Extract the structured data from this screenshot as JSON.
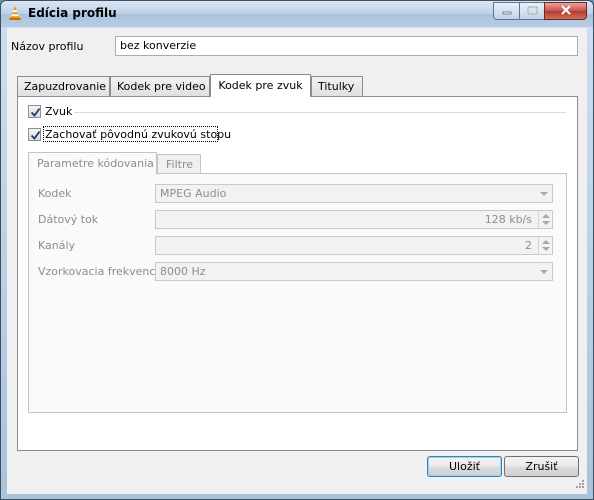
{
  "window": {
    "title": "Edícia profilu",
    "app_icon": "vlc-cone-icon",
    "controls": [
      "minimize-icon",
      "maximize-icon",
      "close-icon"
    ]
  },
  "profile": {
    "label": "Názov profilu",
    "value": "bez konverzie"
  },
  "tabs": [
    {
      "label": "Zapuzdrovanie",
      "active": false
    },
    {
      "label": "Kodek pre video",
      "active": false
    },
    {
      "label": "Kodek pre zvuk",
      "active": true
    },
    {
      "label": "Titulky",
      "active": false
    }
  ],
  "audio": {
    "enable_label": "Zvuk",
    "enable_checked": true,
    "keep_original_label": "Zachovať pôvodnú zvukovú stopu",
    "keep_original_checked": true,
    "subtabs": [
      {
        "label": "Parametre kódovania",
        "active": true
      },
      {
        "label": "Filtre",
        "active": false
      }
    ],
    "fields": {
      "codec": {
        "label": "Kodek",
        "value": "MPEG Audio"
      },
      "bitrate": {
        "label": "Dátový tok",
        "value": "128 kb/s"
      },
      "channels": {
        "label": "Kanály",
        "value": "2"
      },
      "samplerate": {
        "label": "Vzorkovacia frekvencia",
        "value": "8000 Hz"
      }
    }
  },
  "buttons": {
    "save": "Uložiť",
    "cancel": "Zrušiť"
  }
}
